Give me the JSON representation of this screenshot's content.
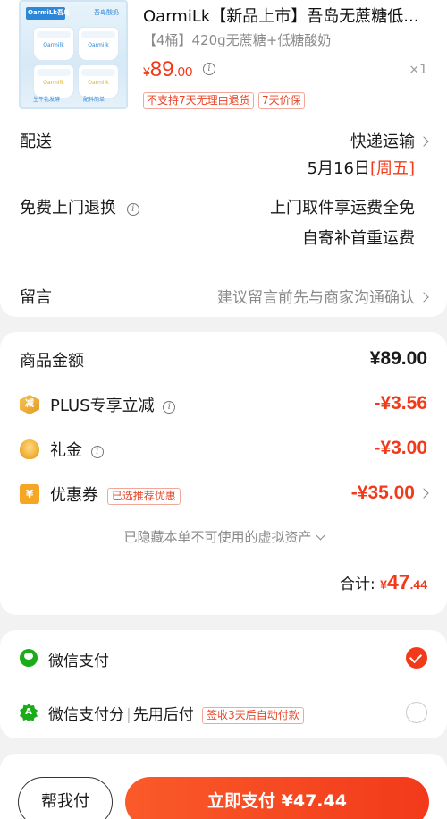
{
  "product": {
    "title": "OarmiLk【新品上市】吾岛无蔗糖低...",
    "spec": "【4桶】420g无蔗糖+低糖酸奶",
    "price_currency": "¥",
    "price_int": "89",
    "price_dec": ".00",
    "quantity": "×1",
    "badges": [
      "不支持7天无理由退货",
      "7天价保"
    ],
    "image_text": {
      "brand": "OarmiLk吾岛",
      "tag": "吾岛酸奶",
      "cup_name": "Oarmilk",
      "bottom_left": "生牛乳发酵",
      "bottom_right": "配料简单"
    }
  },
  "delivery": {
    "label": "配送",
    "method": "快递运输",
    "date": "5月16日",
    "weekday": "[周五]"
  },
  "returns": {
    "label": "免费上门退换",
    "line1": "上门取件享运费全免",
    "line2": "自寄补首重运费"
  },
  "message": {
    "label": "留言",
    "placeholder": "建议留言前先与商家沟通确认"
  },
  "summary": {
    "goods_label": "商品金额",
    "goods_amount": "¥89.00",
    "plus_label": "PLUS专享立减",
    "plus_icon_text": "减",
    "plus_amount": "-¥3.56",
    "gift_label": "礼金",
    "gift_amount": "-¥3.00",
    "coupon_label": "优惠券",
    "coupon_icon_text": "¥",
    "coupon_badge": "已选推荐优惠",
    "coupon_amount": "-¥35.00",
    "hidden_note": "已隐藏本单不可使用的虚拟资产",
    "total_label": "合计:",
    "total_currency": "¥",
    "total_int": "47",
    "total_dec": ".44"
  },
  "payment": {
    "wechat_label": "微信支付",
    "wechat_score_label": "微信支付分",
    "wechat_score_sep": "|",
    "wechat_score_sub": "先用后付",
    "wechat_score_badge": "签收3天后自动付款",
    "wechat_score_icon_text": "A"
  },
  "bottom": {
    "help_label": "帮我付",
    "pay_label": "立即支付 ¥47.44"
  },
  "colors": {
    "accent": "#f23a1a",
    "wechat_green": "#1aad19"
  }
}
